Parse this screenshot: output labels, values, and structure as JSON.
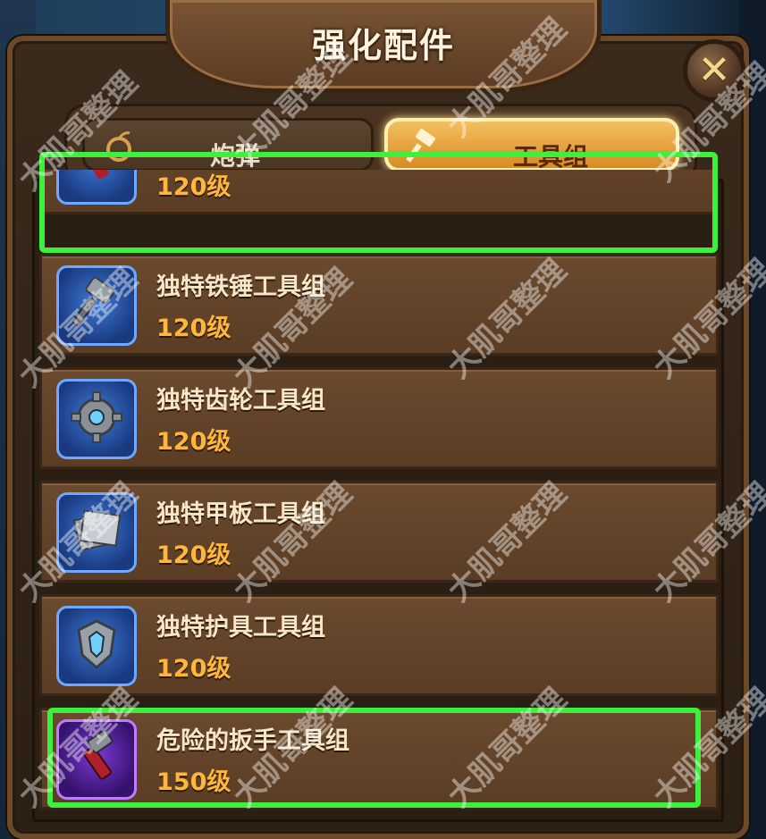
{
  "window": {
    "title": "强化配件",
    "close_icon": "close-x-icon"
  },
  "tabs": [
    {
      "label": "炮弹",
      "icon": "cannonball-icon",
      "active": false
    },
    {
      "label": "工具组",
      "icon": "hammer-icon",
      "active": true
    }
  ],
  "items": [
    {
      "name": "",
      "level": "120级",
      "icon": "wrench-icon",
      "rarity": "blue"
    },
    {
      "name": "独特铁锤工具组",
      "level": "120级",
      "icon": "hammer-icon",
      "rarity": "blue"
    },
    {
      "name": "独特齿轮工具组",
      "level": "120级",
      "icon": "gear-icon",
      "rarity": "blue"
    },
    {
      "name": "独特甲板工具组",
      "level": "120级",
      "icon": "plate-icon",
      "rarity": "blue"
    },
    {
      "name": "独特护具工具组",
      "level": "120级",
      "icon": "shield-icon",
      "rarity": "blue"
    },
    {
      "name": "危险的扳手工具组",
      "level": "150级",
      "icon": "wrench-icon",
      "rarity": "purple"
    }
  ],
  "watermark": "大肌哥整理",
  "colors": {
    "highlight": "#3cf03c",
    "level_text": "#ffb63a",
    "active_tab": "#f4c060"
  }
}
